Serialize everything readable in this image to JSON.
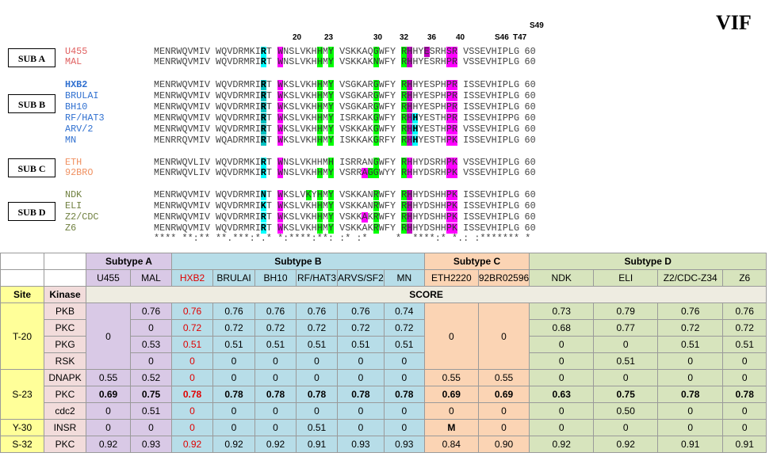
{
  "title": "VIF",
  "site_numbers": [
    {
      "label": "S49",
      "col": 40
    },
    {
      "label": "20",
      "col": 27
    },
    {
      "label": "23",
      "col": 31
    },
    {
      "label": "30",
      "col": 40
    },
    {
      "label": "32",
      "col": 44
    },
    {
      "label": "36",
      "col": 49
    },
    {
      "label": "40",
      "col": 54
    },
    {
      "label": "S46",
      "col": 60
    },
    {
      "label": "T47",
      "col": 64
    }
  ],
  "groups": [
    {
      "label": "SUB A"
    },
    {
      "label": "SUB B"
    },
    {
      "label": "SUB C"
    },
    {
      "label": "SUB D"
    }
  ],
  "sequences": [
    {
      "name": "U455",
      "color": "#e06060",
      "seq": "MENRWQVMIV WQVDRMKIRT WNSLVKHHMY VSKKAQGWFY RHHYESRHSR VSSEVHIPLG",
      "end": "60"
    },
    {
      "name": "MAL",
      "color": "#e06060",
      "seq": "MENRWQVMIV WQVDRMRIRT WNSLVKHHMY VSKKAKNWFY RHHYESRHPR VSSEVHIPLG",
      "end": "60"
    },
    {
      "name": "HXB2",
      "color": "#3070d0",
      "seq": "MENRWQVMIV WQVDRMRIRT WKSLVKHHMY VSGKARGWFY RHHYESPHPR ISSEVHIPLG",
      "end": "60"
    },
    {
      "name": "BRULAI",
      "color": "#3070d0",
      "seq": "MENRWQVMIV WQVDRMRIRT WKSLVKHHMY VSGKARGWFY RHHYESPHPR ISSEVHIPLG",
      "end": "60"
    },
    {
      "name": "BH10",
      "color": "#3070d0",
      "seq": "MENRWQVMIV WQVDRMRIRT WKSLVKHHMY VSGKARGWFY RHHYESPHPR ISSEVHIPLG",
      "end": "60"
    },
    {
      "name": "RF/HAT3",
      "color": "#3070d0",
      "seq": "MENRWQVMIV WQVDRMRIRT WKSLVKHHMY ISRKAKGWFY RHHYESTHPR ISSEVHIPPG",
      "end": "60"
    },
    {
      "name": "ARV/2",
      "color": "#3070d0",
      "seq": "MENRWQVMIV WQVDRMRIRT WKSLVKHHMY VSKKAKGWFY RHHYESTHPR VSSEVHIPLG",
      "end": "60"
    },
    {
      "name": "MN",
      "color": "#3070d0",
      "seq": "MENRRQVMIV WQADRMRIRT WKSLVKHHMY ISKKAKGRFY RHHYESTHPK ISSEVHIPLG",
      "end": "60"
    },
    {
      "name": "ETH",
      "color": "#f09060",
      "seq": "MENRWQVLIV WQVDRMKIRT WNSLVKHHMH ISRRANGWFY RHHYDSRHPK VSSEVHIPLG",
      "end": "60"
    },
    {
      "name": "92BRO",
      "color": "#f09060",
      "seq": "MENRWQVLIV WQVDRMKIRT WNSLVKHHMY VSRRAGGWYY RHHYDSRHPK VSSEVHIPLG",
      "end": "60"
    },
    {
      "name": "NDK",
      "color": "#708040",
      "seq": "MENRWQVMIV WQVDRMRINT WKSLVKYHMY VSKKANRWFY RHHYDSHHPK ISSEVHIPLG",
      "end": "60"
    },
    {
      "name": "ELI",
      "color": "#708040",
      "seq": "MENRWQVMIV WQVDRMRIKT WKSLVKHHMY VSKKANRWFY RHHYDSHHPK ISSEVHIPLG",
      "end": "60"
    },
    {
      "name": "Z2/CDC",
      "color": "#708040",
      "seq": "MENRWQVMIV WQVDRMRIRT WKSLVKHHMY VSKKAKRWFY RHHYDSHHPK ISSEVHIPLG",
      "end": "60"
    },
    {
      "name": "Z6",
      "color": "#708040",
      "seq": "MENRWQVMIV WQVDRMRIRT WKSLVKHHMY VSKKAKRWFY RHHYDSHHPK ISSEVHIPLG",
      "end": "60"
    }
  ],
  "consensus": "**** **:** **.***:*.* *:****:**: :* :*     *  ****:* *.: :******* *",
  "table": {
    "subtypes": [
      "Subtype A",
      "Subtype B",
      "Subtype C",
      "Subtype D"
    ],
    "strains": [
      "U455",
      "MAL",
      "HXB2",
      "BRULAI",
      "BH10",
      "RF/HAT3",
      "ARVS/SF2",
      "MN",
      "ETH2220",
      "92BR02596",
      "NDK",
      "ELI",
      "Z2/CDC-Z34",
      "Z6"
    ],
    "site_header": "Site",
    "kinase_header": "Kinase",
    "score_header": "SCORE",
    "sites": [
      {
        "site": "T-20",
        "rows": [
          {
            "kinase": "PKB",
            "vals": [
              "",
              "0.76",
              "0.76",
              "0.76",
              "0.76",
              "0.76",
              "0.76",
              "0.74",
              "",
              "",
              "0.73",
              "0.79",
              "0.76",
              "0.76"
            ]
          },
          {
            "kinase": "PKC",
            "vals": [
              "",
              "0",
              "0.72",
              "0.72",
              "0.72",
              "0.72",
              "0.72",
              "0.72",
              "",
              "",
              "0.68",
              "0.77",
              "0.72",
              "0.72"
            ]
          },
          {
            "kinase": "PKG",
            "vals": [
              "",
              "0.53",
              "0.51",
              "0.51",
              "0.51",
              "0.51",
              "0.51",
              "0.51",
              "",
              "",
              "0",
              "0",
              "0.51",
              "0.51"
            ]
          },
          {
            "kinase": "RSK",
            "vals": [
              "",
              "0",
              "0",
              "0",
              "0",
              "0",
              "0",
              "0",
              "",
              "",
              "0",
              "0.51",
              "0",
              "0"
            ]
          }
        ],
        "merged": {
          "u455": "0",
          "eth": "0",
          "bro": "0"
        }
      },
      {
        "site": "S-23",
        "rows": [
          {
            "kinase": "DNAPK",
            "vals": [
              "0.55",
              "0.52",
              "0",
              "0",
              "0",
              "0",
              "0",
              "0",
              "0.55",
              "0.55",
              "0",
              "0",
              "0",
              "0"
            ]
          },
          {
            "kinase": "PKC",
            "vals": [
              "0.69",
              "0.75",
              "0.78",
              "0.78",
              "0.78",
              "0.78",
              "0.78",
              "0.78",
              "0.69",
              "0.69",
              "0.63",
              "0.75",
              "0.78",
              "0.78"
            ]
          },
          {
            "kinase": "cdc2",
            "vals": [
              "0",
              "0.51",
              "0",
              "0",
              "0",
              "0",
              "0",
              "0",
              "0",
              "0",
              "0",
              "0.50",
              "0",
              "0"
            ]
          }
        ]
      },
      {
        "site": "Y-30",
        "rows": [
          {
            "kinase": "INSR",
            "vals": [
              "0",
              "0",
              "0",
              "0",
              "0",
              "0.51",
              "0",
              "0",
              "M",
              "0",
              "0",
              "0",
              "0",
              "0"
            ]
          }
        ]
      },
      {
        "site": "S-32",
        "rows": [
          {
            "kinase": "PKC",
            "vals": [
              "0.92",
              "0.93",
              "0.92",
              "0.92",
              "0.92",
              "0.91",
              "0.93",
              "0.93",
              "0.84",
              "0.90",
              "0.92",
              "0.92",
              "0.91",
              "0.91"
            ]
          }
        ]
      }
    ]
  }
}
